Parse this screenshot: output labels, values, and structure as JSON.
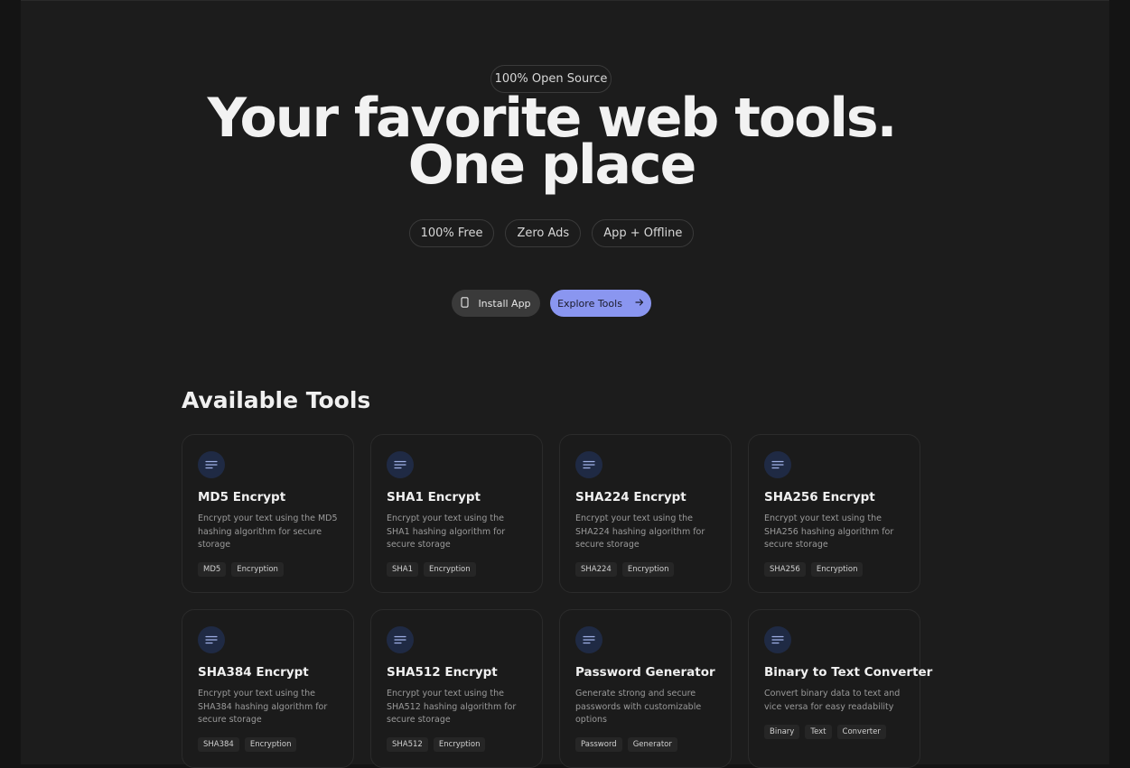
{
  "hero": {
    "badge": "100% Open Source",
    "headline_line1": "Your favorite web tools.",
    "headline_line2": "One place",
    "pills": [
      "100% Free",
      "Zero Ads",
      "App + Offline"
    ],
    "install_label": "Install App",
    "explore_label": "Explore Tools"
  },
  "colors": {
    "accent": "#8a96f0",
    "background": "#1c1c1c"
  },
  "section": {
    "title": "Available Tools"
  },
  "tools": [
    {
      "title": "MD5 Encrypt",
      "desc": "Encrypt your text using the MD5 hashing algorithm for secure storage",
      "tags": [
        "MD5",
        "Encryption"
      ],
      "icon": "text-lines-icon"
    },
    {
      "title": "SHA1 Encrypt",
      "desc": "Encrypt your text using the SHA1 hashing algorithm for secure storage",
      "tags": [
        "SHA1",
        "Encryption"
      ],
      "icon": "text-lines-icon"
    },
    {
      "title": "SHA224 Encrypt",
      "desc": "Encrypt your text using the SHA224 hashing algorithm for secure storage",
      "tags": [
        "SHA224",
        "Encryption"
      ],
      "icon": "text-lines-icon"
    },
    {
      "title": "SHA256 Encrypt",
      "desc": "Encrypt your text using the SHA256 hashing algorithm for secure storage",
      "tags": [
        "SHA256",
        "Encryption"
      ],
      "icon": "text-lines-icon"
    },
    {
      "title": "SHA384 Encrypt",
      "desc": "Encrypt your text using the SHA384 hashing algorithm for secure storage",
      "tags": [
        "SHA384",
        "Encryption"
      ],
      "icon": "text-lines-icon"
    },
    {
      "title": "SHA512 Encrypt",
      "desc": "Encrypt your text using the SHA512 hashing algorithm for secure storage",
      "tags": [
        "SHA512",
        "Encryption"
      ],
      "icon": "text-lines-icon"
    },
    {
      "title": "Password Generator",
      "desc": "Generate strong and secure passwords with customizable options",
      "tags": [
        "Password",
        "Generator"
      ],
      "icon": "text-lines-icon"
    },
    {
      "title": "Binary to Text Converter",
      "desc": "Convert binary data to text and vice versa for easy readability",
      "tags": [
        "Binary",
        "Text",
        "Converter"
      ],
      "icon": "text-lines-icon"
    }
  ]
}
